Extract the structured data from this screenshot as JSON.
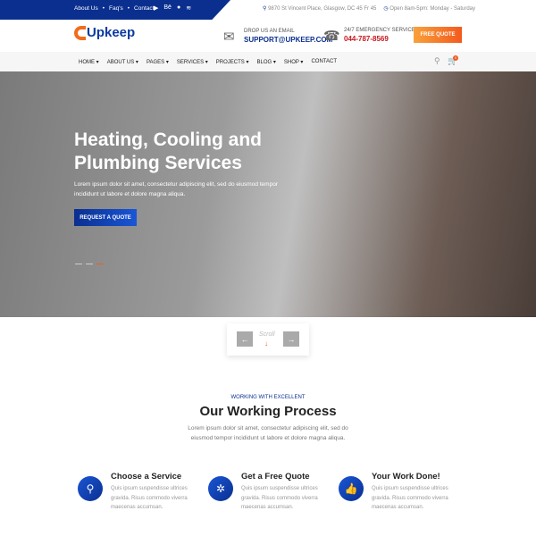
{
  "topbar": {
    "links": [
      "About Us",
      "Faq's",
      "Contact"
    ],
    "social": [
      "youtube-icon",
      "behance-icon",
      "github-icon",
      "rss-icon"
    ],
    "address": "9870 St Vincent Place, Glasgow, DC 45 Fr 45",
    "hours": "Open 8am-5pm: Monday - Saturday"
  },
  "header": {
    "logo": "Upkeep",
    "email_label": "DROP US AN EMAIL",
    "email": "SUPPORT@UPKEEP.COM",
    "phone_label": "24/7 EMERGENCY SERVICE",
    "phone": "044-787-8569",
    "quote_btn": "FREE QUOTE",
    "colors": {
      "brand": "#0a2f8f",
      "accent": "#f35a1e"
    }
  },
  "nav": {
    "items": [
      "HOME",
      "ABOUT US",
      "PAGES",
      "SERVICES",
      "PROJECTS",
      "BLOG",
      "SHOP",
      "CONTACT"
    ],
    "cart_count": "0"
  },
  "hero": {
    "title": "Heating, Cooling and Plumbing Services",
    "text": "Lorem ipsum dolor sit amet, consectetur adipiscing elit, sed do eiusmod tempor incididunt ut labore et dolore magna aliqua.",
    "button": "REQUEST A QUOTE"
  },
  "scroll": {
    "label": "Scroll"
  },
  "process": {
    "subtitle": "WORKING WITH EXCELLENT",
    "title": "Our Working Process",
    "text": "Lorem ipsum dolor sit amet, consectetur adipiscing elit, sed do eiusmod tempor incididunt ut labore et dolore magna aliqua.",
    "steps": [
      {
        "title": "Choose a Service",
        "text": "Quis ipsum suspendisse ultrices gravida. Risus commodo viverra maecenas accumsan.",
        "icon": "search-icon"
      },
      {
        "title": "Get a Free Quote",
        "text": "Quis ipsum suspendisse ultrices gravida. Risus commodo viverra maecenas accumsan.",
        "icon": "gear-icon"
      },
      {
        "title": "Your Work Done!",
        "text": "Quis ipsum suspendisse ultrices gravida. Risus commodo viverra maecenas accumsan.",
        "icon": "thumbs-up-icon"
      }
    ]
  }
}
